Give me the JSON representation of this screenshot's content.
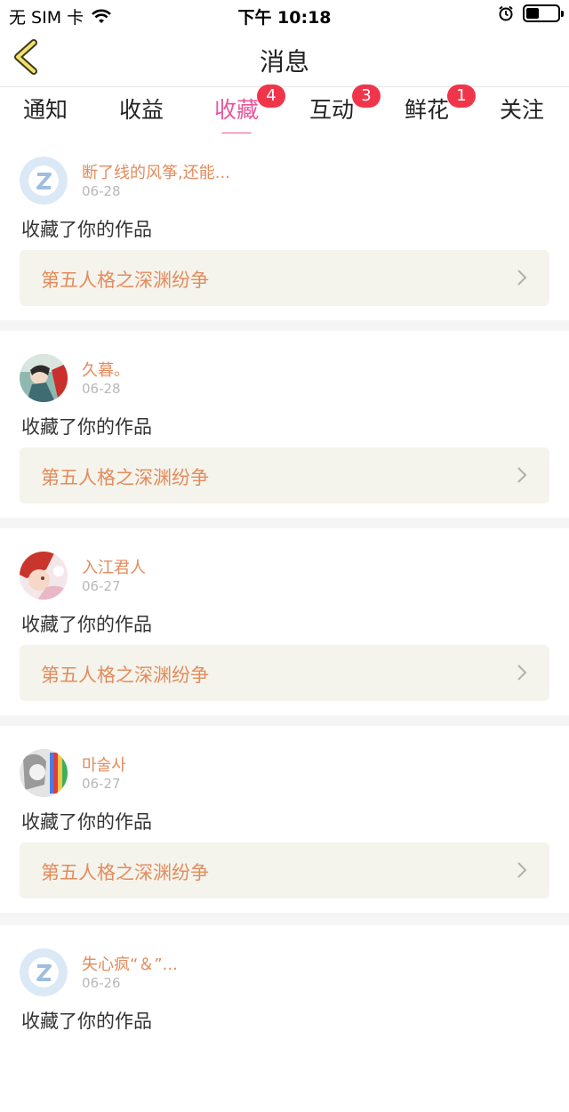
{
  "status_bar": {
    "carrier": "无 SIM 卡",
    "time": "下午 10:18",
    "battery_level": 0.4
  },
  "header": {
    "title": "消息",
    "back_icon": "chevron-left-icon"
  },
  "tabs": [
    {
      "label": "通知",
      "badge": ""
    },
    {
      "label": "收益",
      "badge": ""
    },
    {
      "label": "收藏",
      "badge": "4",
      "active": true
    },
    {
      "label": "互动",
      "badge": "3"
    },
    {
      "label": "鲜花",
      "badge": "1"
    },
    {
      "label": "关注",
      "badge": ""
    }
  ],
  "colors": {
    "accent": "#e8569a",
    "badge": "#f0354a",
    "username": "#e38b5d",
    "work_bg": "#f4f4ec"
  },
  "messages": [
    {
      "user": "断了线的风筝,还能...",
      "date": "06-28",
      "action": "收藏了你的作品",
      "work": "第五人格之深渊纷争",
      "avatar": "default-avatar-icon"
    },
    {
      "user": "久暮。",
      "date": "06-28",
      "action": "收藏了你的作品",
      "work": "第五人格之深渊纷争",
      "avatar": "user-photo-avatar"
    },
    {
      "user": "入江君人",
      "date": "06-27",
      "action": "收藏了你的作品",
      "work": "第五人格之深渊纷争",
      "avatar": "user-photo-avatar"
    },
    {
      "user": "마술사",
      "date": "06-27",
      "action": "收藏了你的作品",
      "work": "第五人格之深渊纷争",
      "avatar": "user-photo-avatar"
    },
    {
      "user": "失心疯“＆”...",
      "date": "06-26",
      "action": "收藏了你的作品",
      "work": "",
      "avatar": "default-avatar-icon"
    }
  ]
}
